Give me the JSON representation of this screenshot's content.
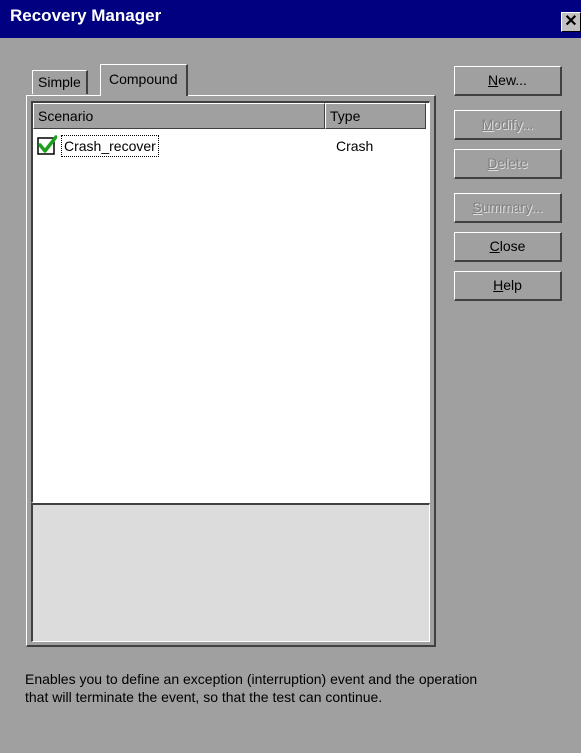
{
  "window": {
    "title": "Recovery Manager",
    "close_glyph": "✕"
  },
  "tabs": [
    {
      "label": "Simple",
      "selected": false
    },
    {
      "label": "Compound",
      "selected": true
    }
  ],
  "list": {
    "columns": [
      "Scenario",
      "Type"
    ],
    "rows": [
      {
        "scenario": "Crash_recover",
        "type": "Crash",
        "checked": true,
        "icon": "green-check-icon"
      }
    ]
  },
  "buttons": {
    "new": {
      "label": "New...",
      "hotkey": "N",
      "rest": "ew...",
      "enabled": true
    },
    "modify": {
      "label": "Modify...",
      "hotkey": "M",
      "rest": "odify...",
      "enabled": false
    },
    "delete": {
      "label": "Delete",
      "hotkey": "D",
      "rest": "elete",
      "enabled": false
    },
    "summary": {
      "label": "Summary...",
      "hotkey": "S",
      "rest": "ummary...",
      "enabled": false
    },
    "close": {
      "label": "Close",
      "hotkey": "C",
      "rest": "lose",
      "enabled": true
    },
    "help": {
      "label": "Help",
      "hotkey": "H",
      "rest": "elp",
      "enabled": true
    }
  },
  "footer": {
    "line1": "Enables you to define an exception (interruption) event and the operation",
    "line2": "that will terminate the event, so that the test can continue."
  },
  "colors": {
    "titlebar": "#000080",
    "face": "#a0a0a0",
    "check": "#1ea01e"
  }
}
